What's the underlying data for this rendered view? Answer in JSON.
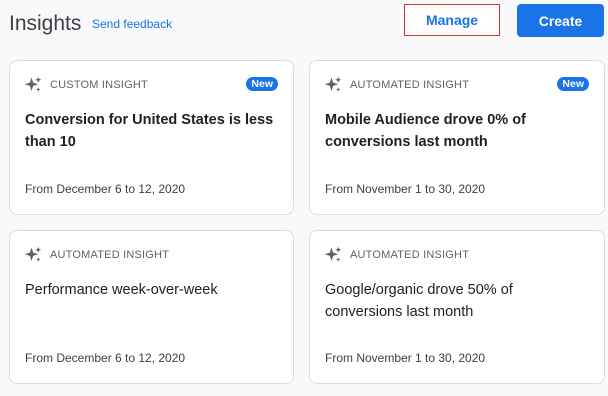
{
  "header": {
    "title": "Insights",
    "send_feedback": "Send feedback",
    "manage_label": "Manage",
    "create_label": "Create"
  },
  "cards": [
    {
      "kind": "CUSTOM INSIGHT",
      "badge": "New",
      "headline": "Conversion for United States is less than 10",
      "date": "From December 6 to 12, 2020",
      "icon": "sparkle-icon"
    },
    {
      "kind": "AUTOMATED INSIGHT",
      "badge": "New",
      "headline": "Mobile Audience drove 0% of conversions last month",
      "date": "From November 1 to 30, 2020",
      "icon": "sparkle-icon"
    },
    {
      "kind": "AUTOMATED INSIGHT",
      "headline": "Performance week-over-week",
      "date": "From December 6 to 12, 2020",
      "icon": "sparkle-icon"
    },
    {
      "kind": "AUTOMATED INSIGHT",
      "headline": "Google/organic drove 50% of conversions last month",
      "date": "From November 1 to 30, 2020",
      "icon": "sparkle-icon"
    }
  ],
  "colors": {
    "accent": "#1a73e8",
    "manage_border": "#d93025",
    "card_border": "#dadce0",
    "background": "#f8f9fa"
  }
}
